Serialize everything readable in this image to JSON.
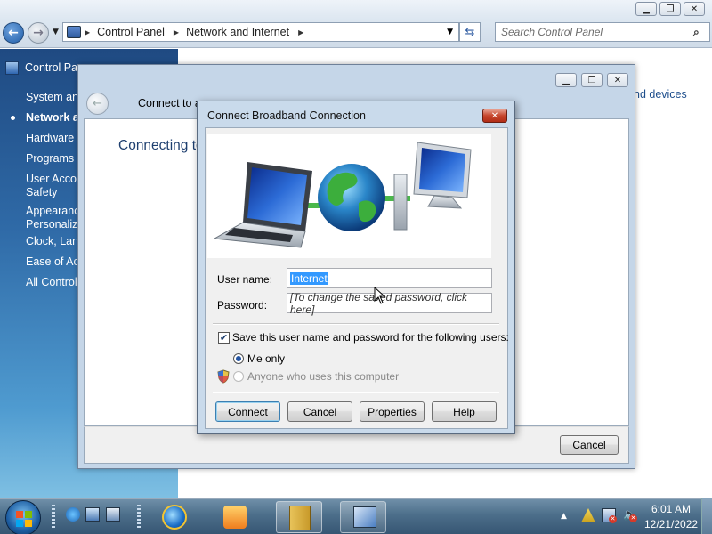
{
  "explorer": {
    "breadcrumbs": [
      "Control Panel",
      "Network and Internet"
    ],
    "search_placeholder": "Search Control Panel",
    "background_text": "nd devices"
  },
  "sidebar": {
    "title": "Control Panel Home",
    "items": [
      {
        "label": "System and Security",
        "active": false
      },
      {
        "label": "Network and Internet",
        "active": true
      },
      {
        "label": "Hardware and Sound",
        "active": false
      },
      {
        "label": "Programs",
        "active": false
      },
      {
        "label": "User Accounts and Family Safety",
        "line1": "User Accounts and",
        "line2": "Safety",
        "active": false
      },
      {
        "label": "Appearance and Personalization",
        "line1": "Appearance and",
        "line2": "Personalization",
        "active": false
      },
      {
        "label": "Clock, Language, and Region",
        "active": false
      },
      {
        "label": "Ease of Access",
        "active": false
      },
      {
        "label": "All Control Panel Items",
        "active": false
      }
    ]
  },
  "connect_window": {
    "title": "Connect to a network",
    "heading": "Connecting to Internet",
    "cancel_label": "Cancel"
  },
  "dialog": {
    "title": "Connect Broadband Connection",
    "username_label": "User name:",
    "username_value": "Internet",
    "password_label": "Password:",
    "password_value": "[To change the saved password, click here]",
    "save_label": "Save this user name and password for the following users:",
    "save_checked": true,
    "me_only_label": "Me only",
    "anyone_label": "Anyone who uses this computer",
    "buttons": {
      "connect": "Connect",
      "cancel": "Cancel",
      "properties": "Properties",
      "help": "Help"
    }
  },
  "taskbar": {
    "time": "6:01 AM",
    "date": "12/21/2022"
  },
  "colors": {
    "selection": "#3399ff",
    "sidebar_top": "#1f4a82",
    "close_red": "#c6452c"
  }
}
